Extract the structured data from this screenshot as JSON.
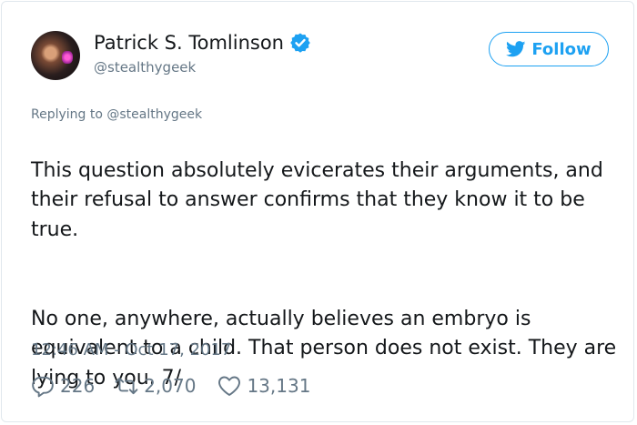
{
  "author": {
    "name": "Patrick S. Tomlinson",
    "handle": "@stealthygeek",
    "verified_icon": "verified-badge-icon"
  },
  "follow_button": {
    "label": "Follow",
    "icon": "twitter-bird-icon"
  },
  "tweet": {
    "replying_to": "Replying to @stealthygeek",
    "paragraph_1": "This question absolutely evicerates their arguments, and their refusal to answer confirms that they know it to be true.",
    "paragraph_2": "No one, anywhere, actually believes an embryo is equivalent to a child. That person does not exist. They are lying to you. 7/",
    "timestamp": "12:46 AM - Oct 17, 2017"
  },
  "stats": {
    "replies": "226",
    "retweets": "2,070",
    "likes": "13,131"
  },
  "colors": {
    "accent": "#1da1f2",
    "text": "#14171a",
    "muted": "#657786",
    "border": "#e1e8ed"
  }
}
